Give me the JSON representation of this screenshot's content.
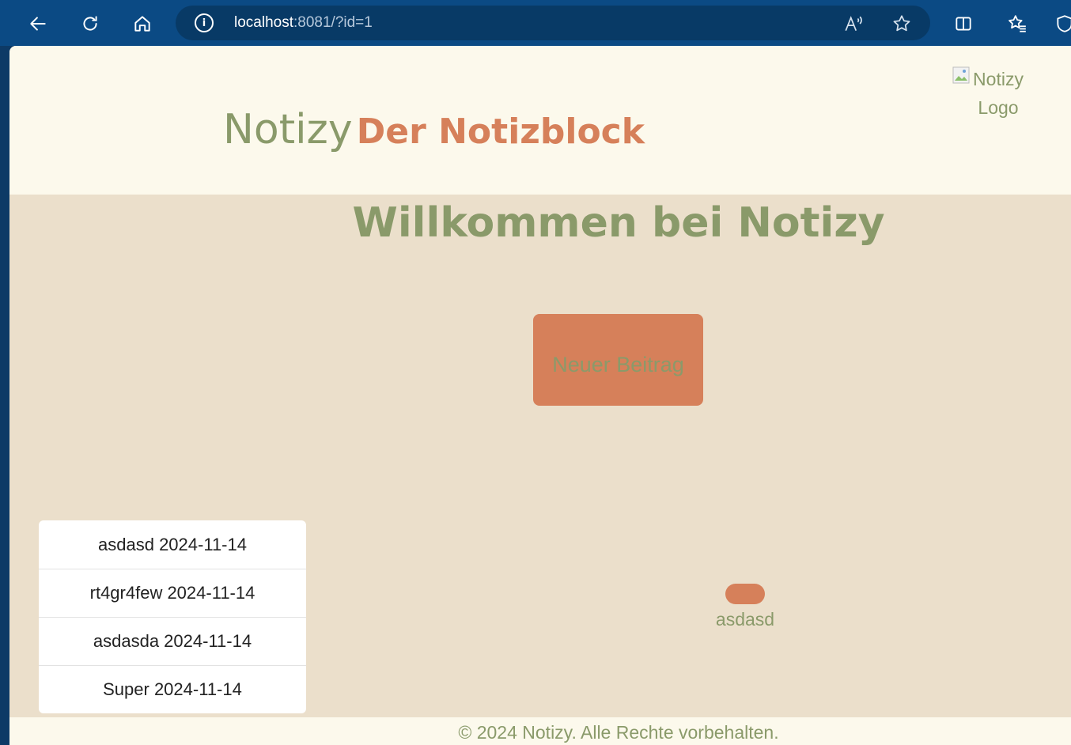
{
  "browser": {
    "url_host": "localhost",
    "url_rest": ":8081/?id=1"
  },
  "header": {
    "brand_name": "Notizy",
    "brand_tagline": "Der Notizblock",
    "logo_alt": "Notizy Logo"
  },
  "main": {
    "welcome_title": "Willkommen bei Notizy",
    "new_post_label": "Neuer Beitrag",
    "notes": [
      {
        "label": "asdasd 2024-11-14"
      },
      {
        "label": "rt4gr4few 2024-11-14"
      },
      {
        "label": "asdasda 2024-11-14"
      },
      {
        "label": "Super 2024-11-14"
      }
    ],
    "selected_note_label": "asdasd"
  },
  "footer": {
    "copyright": "© 2024 Notizy. Alle Rechte vorbehalten."
  },
  "colors": {
    "chrome": "#0b4a84",
    "accent_orange": "#d6805a",
    "accent_green": "#8a9a6a",
    "background": "#ebdfcb",
    "header_bg": "#fcf9ec"
  }
}
